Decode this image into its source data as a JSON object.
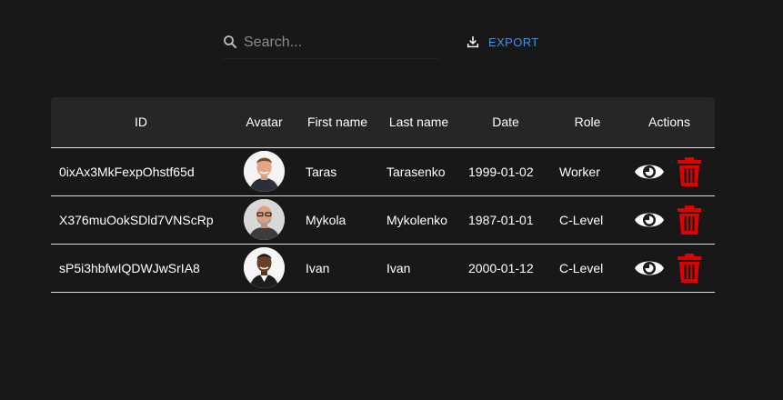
{
  "search": {
    "placeholder": "Search...",
    "value": ""
  },
  "toolbar": {
    "export_label": "EXPORT"
  },
  "table": {
    "headers": [
      "ID",
      "Avatar",
      "First name",
      "Last name",
      "Date",
      "Role",
      "Actions"
    ],
    "rows": [
      {
        "id": "0ixAx3MkFexpOhstf65d",
        "first_name": "Taras",
        "last_name": "Tarasenko",
        "date": "1999-01-02",
        "role": "Worker"
      },
      {
        "id": "X376muOokSDld7VNScRp",
        "first_name": "Mykola",
        "last_name": "Mykolenko",
        "date": "1987-01-01",
        "role": "C-Level"
      },
      {
        "id": "sP5i3hbfwIQDWJwSrIA8",
        "first_name": "Ivan",
        "last_name": "Ivan",
        "date": "2000-01-12",
        "role": "C-Level"
      }
    ]
  },
  "icons": {
    "search": "search-icon",
    "export": "download-icon",
    "view": "eye-icon",
    "delete": "trash-icon"
  },
  "colors": {
    "background": "#181818",
    "header_bg": "#262626",
    "accent": "#4a90d9",
    "danger": "#e00000"
  }
}
